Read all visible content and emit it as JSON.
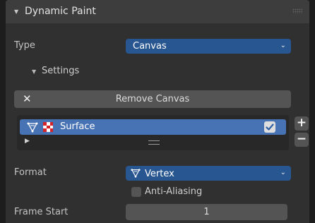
{
  "panel": {
    "title": "Dynamic Paint"
  },
  "type_field": {
    "label": "Type",
    "value": "Canvas"
  },
  "settings": {
    "title": "Settings"
  },
  "remove_button": {
    "label": "Remove Canvas"
  },
  "surface_list": {
    "items": [
      {
        "label": "Surface",
        "enabled": true
      }
    ]
  },
  "list_controls": {
    "add": "+",
    "remove": "−"
  },
  "format_field": {
    "label": "Format",
    "value": "Vertex"
  },
  "anti_aliasing": {
    "label": "Anti-Aliasing",
    "checked": false
  },
  "frame_start": {
    "label": "Frame Start",
    "value": "1"
  },
  "colors": {
    "accent": "#285690",
    "selection": "#4772b3",
    "panel": "#303030",
    "header": "#3d3d3d"
  }
}
